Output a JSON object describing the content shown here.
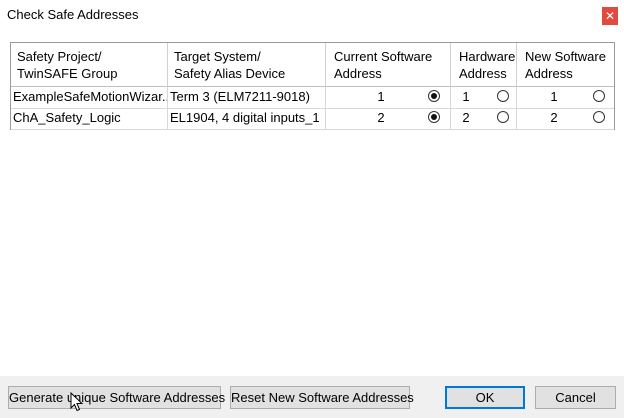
{
  "window": {
    "title": "Check Safe Addresses",
    "close_glyph": "✕"
  },
  "table": {
    "headers": [
      {
        "line1": "Safety Project/",
        "line2": "TwinSAFE Group"
      },
      {
        "line1": "Target System/",
        "line2": "Safety Alias Device"
      },
      {
        "line1": "Current Software",
        "line2": "Address"
      },
      {
        "line1": "Hardware",
        "line2": "Address"
      },
      {
        "line1": "New Software",
        "line2": "Address"
      }
    ],
    "rows": [
      {
        "project": "ExampleSafeMotionWizar...",
        "target": "Term 3 (ELM7211-9018)",
        "current": "1",
        "current_selected": true,
        "hardware": "1",
        "hardware_selected": false,
        "new": "1",
        "new_selected": false
      },
      {
        "project": "ChA_Safety_Logic",
        "target": "EL1904, 4 digital inputs_1",
        "current": "2",
        "current_selected": true,
        "hardware": "2",
        "hardware_selected": false,
        "new": "2",
        "new_selected": false
      }
    ]
  },
  "buttons": {
    "generate": "Generate unique Software Addresses",
    "reset": "Reset New Software Addresses",
    "ok": "OK",
    "cancel": "Cancel"
  },
  "colors": {
    "close_button": "#e04a3f",
    "default_button_border": "#0078d7"
  },
  "icons": {
    "close": "close-icon",
    "cursor": "mouse-cursor-icon"
  }
}
